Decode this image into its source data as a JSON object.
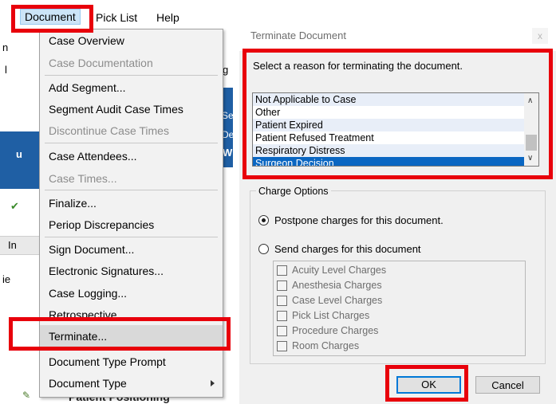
{
  "menubar": {
    "items": [
      {
        "label": "Document"
      },
      {
        "label": "Pick List"
      },
      {
        "label": "Help"
      }
    ]
  },
  "background_fragments": {
    "left_edge": [
      "n",
      "l",
      "u",
      "In",
      "ie"
    ],
    "right_edge": [
      "g",
      "Se",
      "De",
      "W"
    ],
    "bottom_label": "Patient Positioning"
  },
  "document_menu": {
    "items": [
      {
        "label": "Case Overview",
        "disabled": false
      },
      {
        "label": "Case Documentation",
        "disabled": true
      },
      {
        "label": "Add Segment...",
        "disabled": false
      },
      {
        "label": "Segment Audit Case Times",
        "disabled": false
      },
      {
        "label": "Discontinue Case Times",
        "disabled": true
      },
      {
        "label": "Case Attendees...",
        "disabled": false
      },
      {
        "label": "Case Times...",
        "disabled": true
      },
      {
        "label": "Finalize...",
        "disabled": false
      },
      {
        "label": "Periop Discrepancies",
        "disabled": false
      },
      {
        "label": "Sign Document...",
        "disabled": false
      },
      {
        "label": "Electronic Signatures...",
        "disabled": false
      },
      {
        "label": "Case Logging...",
        "disabled": false
      },
      {
        "label": "Retrospective...",
        "disabled": false
      },
      {
        "label": "Terminate...",
        "disabled": false,
        "highlighted": true
      },
      {
        "label": "Document Type Prompt",
        "disabled": false
      },
      {
        "label": "Document Type",
        "disabled": false,
        "submenu": true
      }
    ]
  },
  "dialog": {
    "title": "Terminate Document",
    "close_label": "x",
    "prompt": "Select a reason for terminating the document.",
    "reasons": [
      {
        "label": "Not Applicable to Case"
      },
      {
        "label": "Other"
      },
      {
        "label": "Patient Expired"
      },
      {
        "label": "Patient Refused Treatment"
      },
      {
        "label": "Respiratory Distress"
      },
      {
        "label": "Surgeon Decision",
        "selected": true
      }
    ],
    "charge_options": {
      "legend": "Charge Options",
      "postpone_label": "Postpone charges for this document.",
      "send_label": "Send charges for this document",
      "selected": "postpone",
      "charges": [
        "Acuity Level Charges",
        "Anesthesia Charges",
        "Case Level Charges",
        "Pick List Charges",
        "Procedure Charges",
        "Room Charges"
      ]
    },
    "ok_label": "OK",
    "cancel_label": "Cancel"
  },
  "colors": {
    "callout": "#e8000b",
    "selection": "#0a66c2",
    "menu_highlight": "#d9d9d9",
    "app_blue": "#1f5fa4"
  }
}
